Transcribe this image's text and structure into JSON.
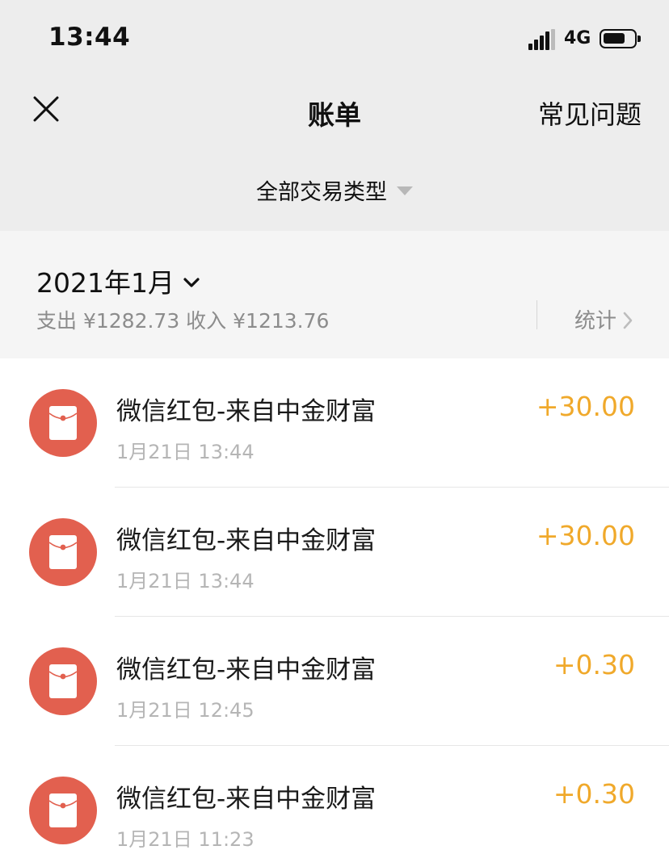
{
  "status_bar": {
    "time": "13:44",
    "network": "4G"
  },
  "nav": {
    "title": "账单",
    "faq": "常见问题"
  },
  "filter": {
    "label": "全部交易类型"
  },
  "month": {
    "label": "2021年1月",
    "summary": "支出 ¥1282.73 收入 ¥1213.76",
    "stats": "统计"
  },
  "transactions": [
    {
      "title": "微信红包-来自中金财富",
      "date": "1月21日 13:44",
      "amount": "+30.00"
    },
    {
      "title": "微信红包-来自中金财富",
      "date": "1月21日 13:44",
      "amount": "+30.00"
    },
    {
      "title": "微信红包-来自中金财富",
      "date": "1月21日 12:45",
      "amount": "+0.30"
    },
    {
      "title": "微信红包-来自中金财富",
      "date": "1月21日 11:23",
      "amount": "+0.30"
    }
  ],
  "colors": {
    "header_bg": "#ededed",
    "red_packet": "#e2604f",
    "income_amount": "#f0a92b"
  }
}
